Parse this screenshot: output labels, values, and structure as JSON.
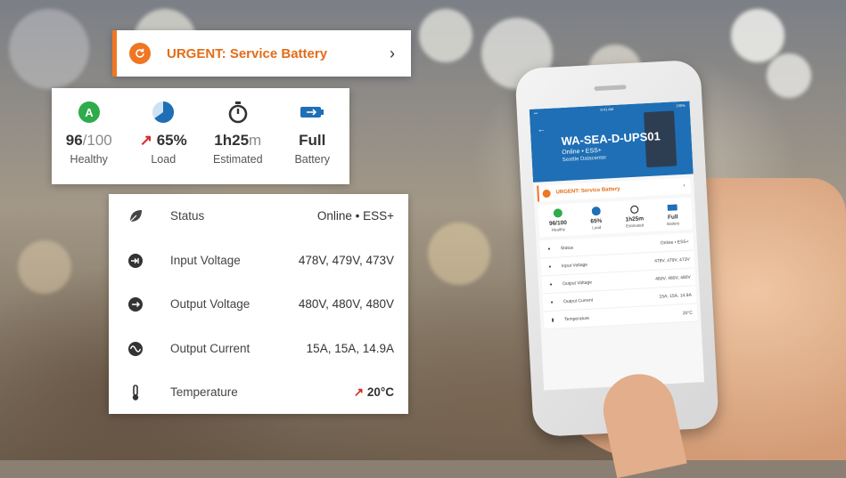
{
  "urgent": {
    "text": "URGENT: Service Battery",
    "chevron": "›",
    "icon": "refresh-circle-icon",
    "color": "#ef7622"
  },
  "metrics": [
    {
      "icon": "grade-a-icon",
      "value_main": "96",
      "value_dim": "/100",
      "label": "Healthy"
    },
    {
      "icon": "pie-chart-icon",
      "value_main": "65%",
      "value_dim": "",
      "label": "Load"
    },
    {
      "icon": "stopwatch-icon",
      "value_main": "1h25",
      "value_dim": "m",
      "label": "Estimated"
    },
    {
      "icon": "battery-icon",
      "value_main": "Full",
      "value_dim": "",
      "label": "Battery"
    }
  ],
  "details": [
    {
      "icon": "leaf-icon",
      "label": "Status",
      "value": "Online • ESS+"
    },
    {
      "icon": "input-plug-icon",
      "label": "Input Voltage",
      "value": "478V, 479V, 473V"
    },
    {
      "icon": "output-plug-icon",
      "label": "Output Voltage",
      "value": "480V, 480V, 480V"
    },
    {
      "icon": "sine-wave-icon",
      "label": "Output Current",
      "value": "15A, 15A, 14.9A"
    },
    {
      "icon": "thermometer-icon",
      "label": "Temperature",
      "value": "20°C"
    }
  ],
  "phone": {
    "status_left": "•••",
    "status_time": "9:41 AM",
    "status_right": "100%",
    "back": "←",
    "device_name": "WA-SEA-D-UPS01",
    "device_status": "Online • ESS+",
    "device_location": "Seattle Datacenter",
    "urgent": "URGENT: Service Battery",
    "metrics": [
      {
        "value": "96/100",
        "label": "Healthy"
      },
      {
        "value": "65%",
        "label": "Load"
      },
      {
        "value": "1h25m",
        "label": "Estimated"
      },
      {
        "value": "Full",
        "label": "Battery"
      }
    ],
    "rows": [
      {
        "label": "Status",
        "value": "Online • ESS+"
      },
      {
        "label": "Input Voltage",
        "value": "478V, 479V, 473V"
      },
      {
        "label": "Output Voltage",
        "value": "480V, 480V, 480V"
      },
      {
        "label": "Output Current",
        "value": "15A, 15A, 14.9A"
      },
      {
        "label": "Temperature",
        "value": "20°C"
      }
    ]
  },
  "colors": {
    "accent": "#ef7622",
    "green": "#2eab4a",
    "blue": "#1e6fb5",
    "red": "#d72a2a"
  }
}
